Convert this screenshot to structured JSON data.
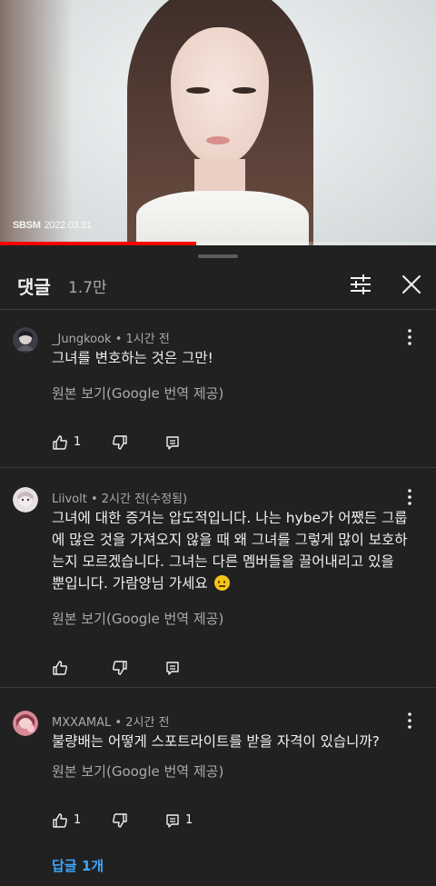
{
  "video": {
    "watermark_brand": "SBS",
    "watermark_channel": "M",
    "watermark_date": "2022.03.31",
    "progress_fraction": 0.45
  },
  "header": {
    "title": "댓글",
    "count": "1.7만",
    "sort_icon": "sort-icon",
    "close_icon": "close-icon"
  },
  "comments": [
    {
      "author": "_Jungkook",
      "time": "1시간 전",
      "text": "그녀를 변호하는 것은 그만!",
      "translate": "원본 보기(Google 번역 제공)",
      "likes": "1",
      "replies_count": ""
    },
    {
      "author": "Liivolt",
      "time": "2시간 전(수정됨)",
      "text": "그녀에 대한 증거는 압도적입니다. 나는 hybe가 어쨌든 그룹에 많은 것을 가져오지 않을 때 왜 그녀를 그렇게 많이 보호하는지 모르겠습니다. 그녀는 다른 멤버들을 끌어내리고 있을 뿐입니다. 가람양님 가세요",
      "translate": "원본 보기(Google 번역 제공)",
      "likes": "",
      "replies_count": ""
    },
    {
      "author": "MXXAMAL",
      "time": "2시간 전",
      "text": "불량배는 어떻게 스포트라이트를 받을 자격이 있습니까?",
      "translate": "원본 보기(Google 번역 제공)",
      "likes": "1",
      "replies_count": "1",
      "replies_link": "답글 1개"
    }
  ],
  "colors": {
    "background": "#212121",
    "text_primary": "#f1f1f1",
    "text_secondary": "#aaaaaa",
    "link": "#3ea6ff",
    "progress": "#ff0000"
  }
}
